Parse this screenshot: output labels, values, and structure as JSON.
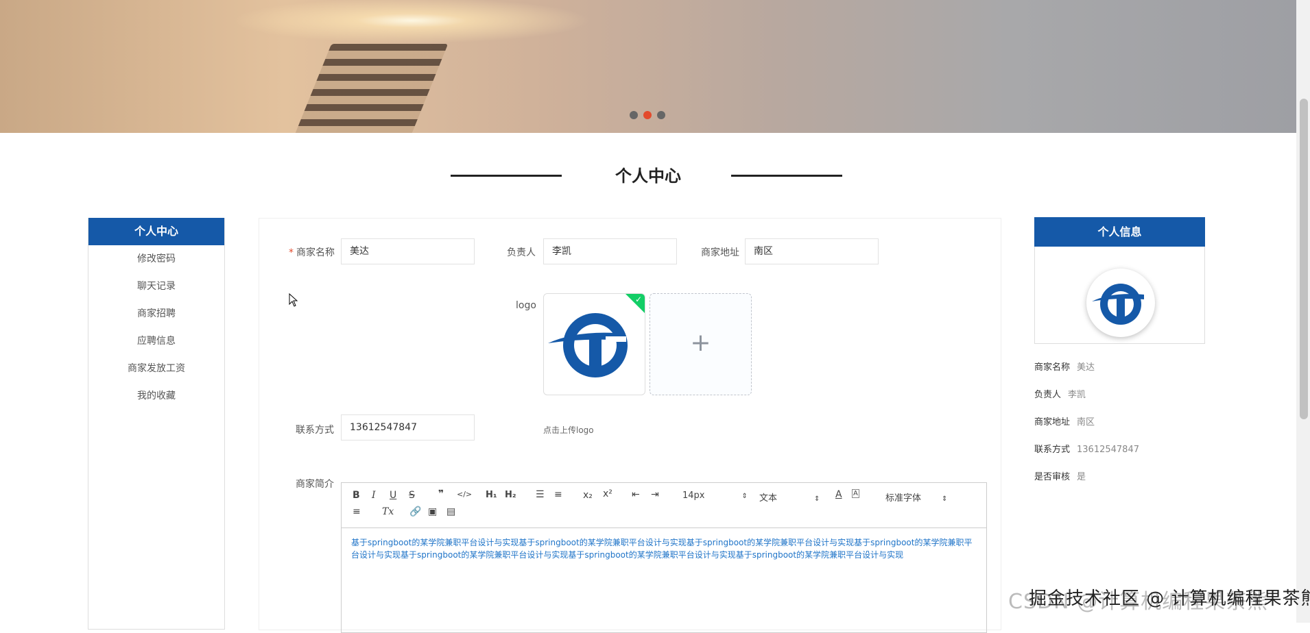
{
  "banner": {
    "active_dot_index": 1,
    "dot_count": 3
  },
  "page_title": "个人中心",
  "left_menu": {
    "header": "个人中心",
    "items": [
      "修改密码",
      "聊天记录",
      "商家招聘",
      "应聘信息",
      "商家发放工资",
      "我的收藏"
    ]
  },
  "form": {
    "merchant_name_label": "商家名称",
    "merchant_name_value": "美达",
    "owner_label": "负责人",
    "owner_value": "李凯",
    "address_label": "商家地址",
    "address_value": "南区",
    "logo_label": "logo",
    "upload_hint": "点击上传logo",
    "contact_label": "联系方式",
    "contact_value": "13612547847",
    "intro_label": "商家简介"
  },
  "editor": {
    "font_size": "14px",
    "paragraph": "文本",
    "font_family": "标准字体",
    "content": "基于springboot的某学院兼职平台设计与实现基于springboot的某学院兼职平台设计与实现基于springboot的某学院兼职平台设计与实现基于springboot的某学院兼职平台设计与实现基于springboot的某学院兼职平台设计与实现基于springboot的某学院兼职平台设计与实现基于springboot的某学院兼职平台设计与实现",
    "toolbar_icons": [
      "bold-icon",
      "italic-icon",
      "underline-icon",
      "strike-icon",
      "quote-icon",
      "code-icon",
      "h1-icon",
      "h2-icon",
      "ordered-list-icon",
      "bullet-list-icon",
      "subscript-icon",
      "superscript-icon",
      "outdent-icon",
      "indent-icon",
      "font-color-icon",
      "background-color-icon",
      "align-icon",
      "clear-format-icon",
      "link-icon",
      "image-icon",
      "video-icon"
    ]
  },
  "info_panel": {
    "header": "个人信息",
    "rows": [
      {
        "key": "商家名称",
        "value": "美达"
      },
      {
        "key": "负责人",
        "value": "李凯"
      },
      {
        "key": "商家地址",
        "value": "南区"
      },
      {
        "key": "联系方式",
        "value": "13612547847"
      },
      {
        "key": "是否审核",
        "value": "是"
      }
    ]
  },
  "watermark": {
    "back": "CSDN @计算机编程果茶熊",
    "front": "掘金技术社区 @ 计算机编程果茶熊"
  },
  "colors": {
    "primary": "#1559a8",
    "accent": "#e34a2c",
    "success": "#13ce66",
    "editor_text": "#1f74c8"
  }
}
